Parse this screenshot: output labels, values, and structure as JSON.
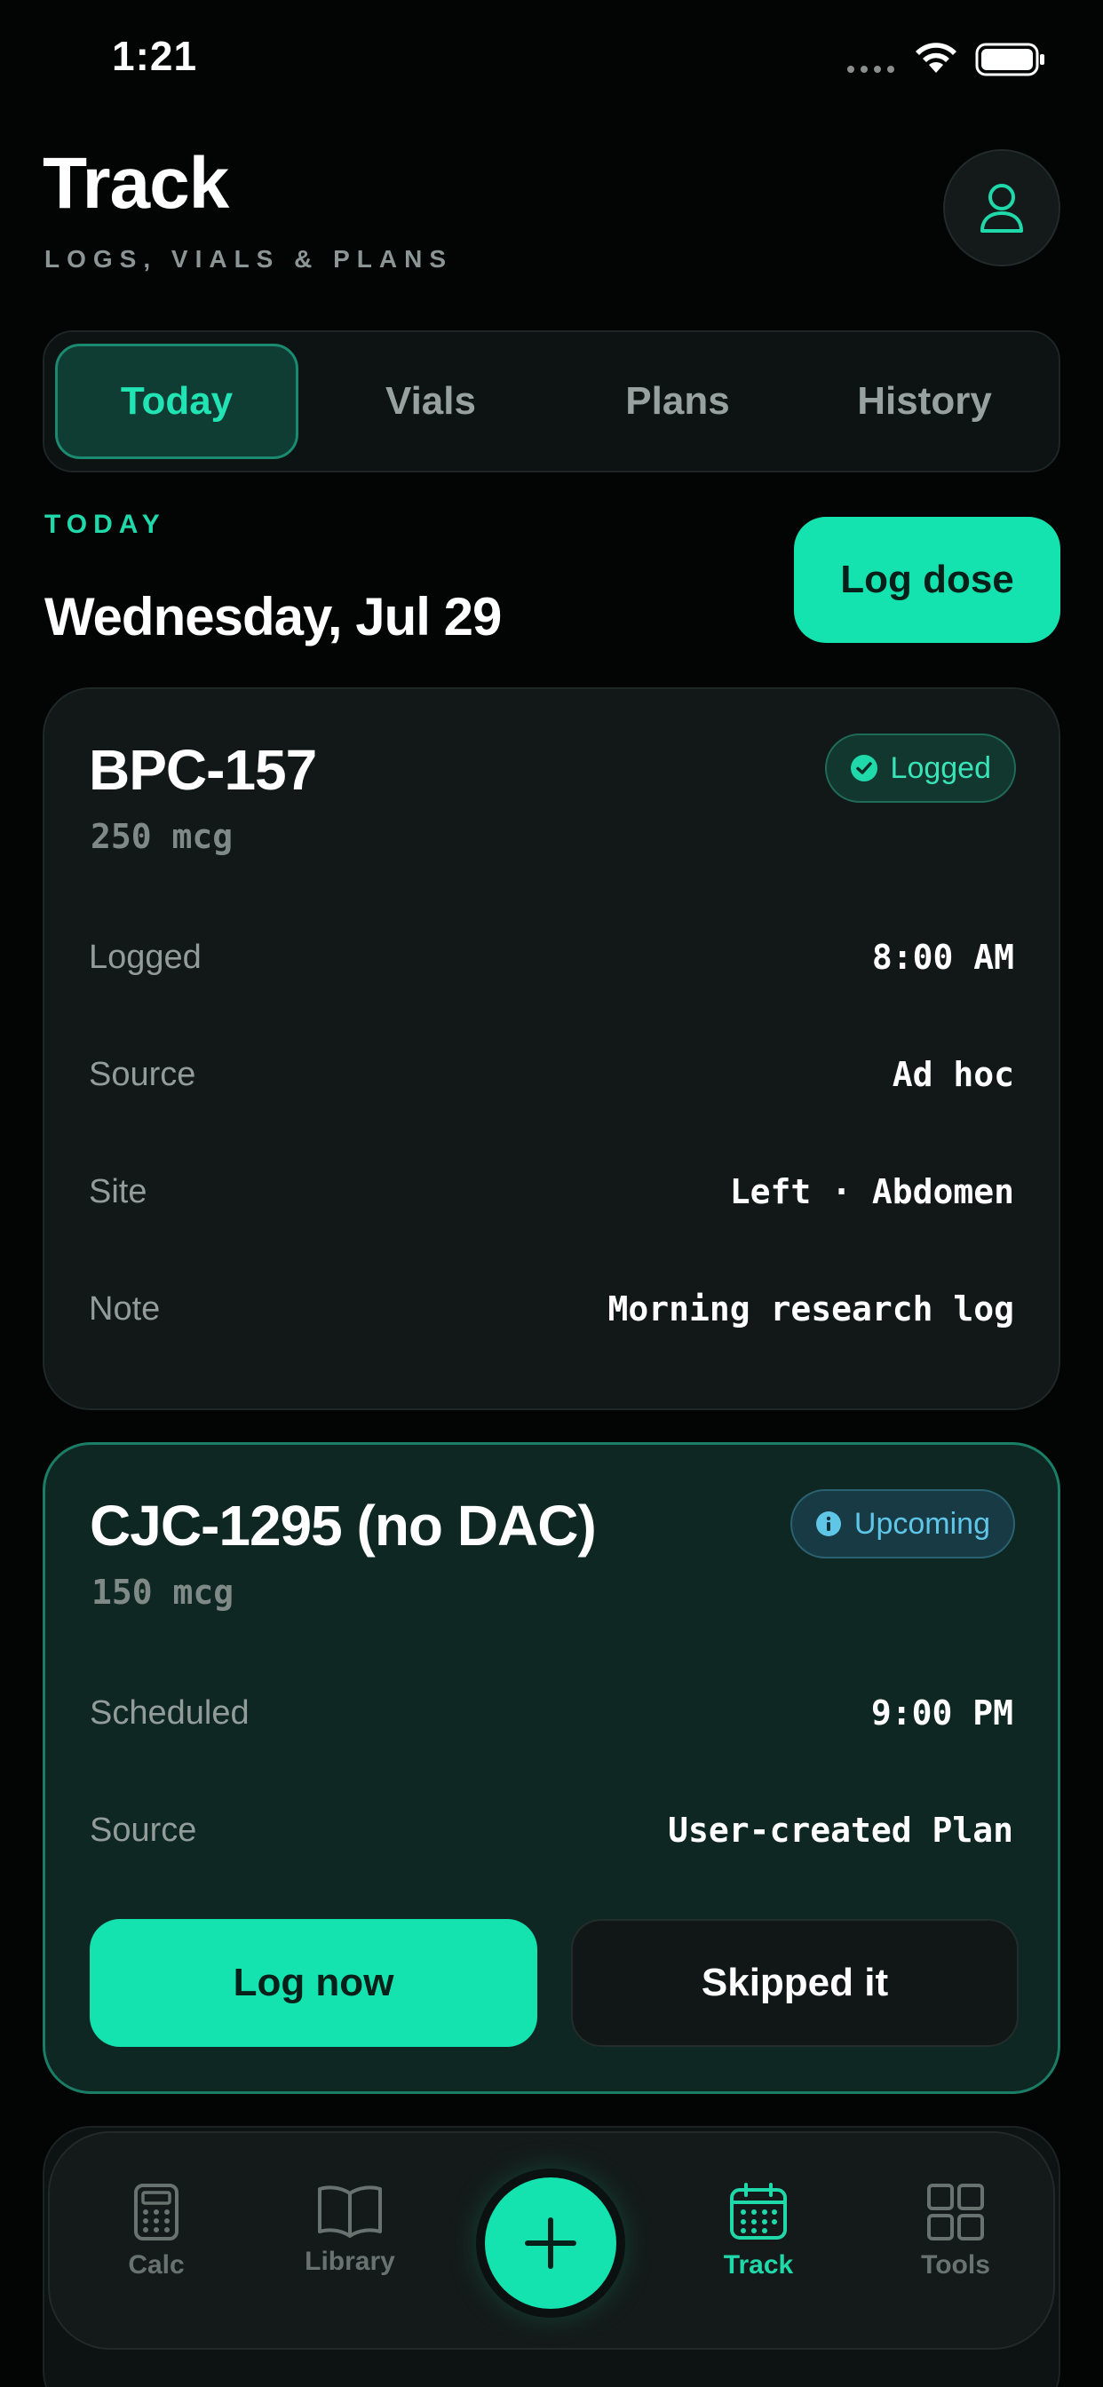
{
  "status_bar": {
    "time": "1:21"
  },
  "header": {
    "title": "Track",
    "subtitle": "LOGS, VIALS & PLANS"
  },
  "tabs": [
    {
      "label": "Today",
      "active": true
    },
    {
      "label": "Vials",
      "active": false
    },
    {
      "label": "Plans",
      "active": false
    },
    {
      "label": "History",
      "active": false
    }
  ],
  "today": {
    "section_label": "TODAY",
    "date": "Wednesday, Jul 29",
    "log_dose_label": "Log dose"
  },
  "cards": [
    {
      "name": "BPC-157",
      "dose": "250 mcg",
      "status": "Logged",
      "status_icon": "check-circle-icon",
      "rows": [
        {
          "label": "Logged",
          "value": "8:00 AM"
        },
        {
          "label": "Source",
          "value": "Ad hoc"
        },
        {
          "label": "Site",
          "value": "Left · Abdomen"
        },
        {
          "label": "Note",
          "value": "Morning research log"
        }
      ]
    },
    {
      "name": "CJC-1295 (no DAC)",
      "dose": "150 mcg",
      "status": "Upcoming",
      "status_icon": "info-icon",
      "rows": [
        {
          "label": "Scheduled",
          "value": "9:00 PM"
        },
        {
          "label": "Source",
          "value": "User-created Plan"
        }
      ],
      "actions": {
        "primary": "Log now",
        "secondary": "Skipped it"
      }
    }
  ],
  "bottom_nav": [
    {
      "label": "Calc",
      "icon": "calculator-icon",
      "active": false
    },
    {
      "label": "Library",
      "icon": "book-icon",
      "active": false
    },
    {
      "label": "",
      "icon": "plus-icon",
      "active": false
    },
    {
      "label": "Track",
      "icon": "calendar-icon",
      "active": true
    },
    {
      "label": "Tools",
      "icon": "grid-icon",
      "active": false
    }
  ],
  "colors": {
    "accent": "#14e3b0",
    "background": "#030404",
    "card": "#111817",
    "upcoming_card": "#0f2723",
    "info_blue": "#60c6e8"
  }
}
